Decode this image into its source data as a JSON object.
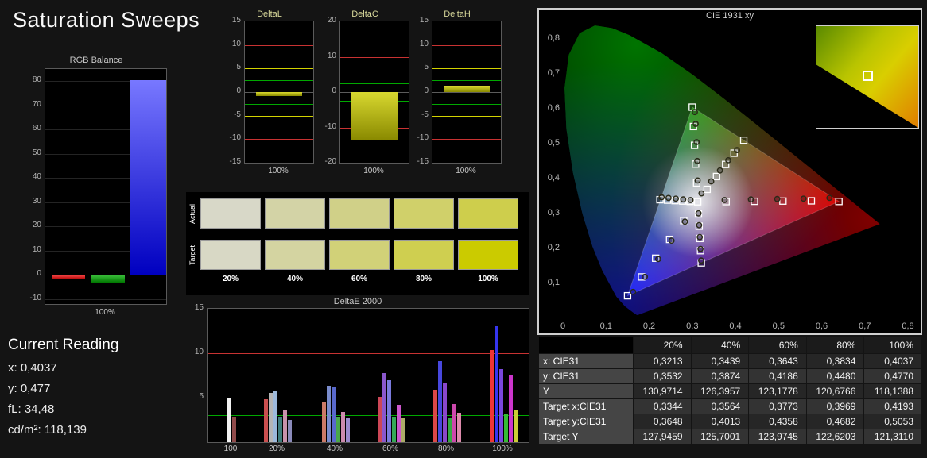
{
  "title": "Saturation Sweeps",
  "current_reading": {
    "heading": "Current Reading",
    "x": "x: 0,4037",
    "y": "y: 0,477",
    "fl": "fL: 34,48",
    "cd": "cd/m²: 118,139"
  },
  "chart_data": {
    "rgb_balance": {
      "type": "bar",
      "title": "RGB Balance",
      "categories": [
        "Red",
        "Green",
        "Blue"
      ],
      "values": [
        -1.7,
        -3.0,
        80.4
      ],
      "colors": [
        [
          "#ff5050",
          "#aa0000"
        ],
        [
          "#3fc43f",
          "#007700"
        ],
        [
          "#7878ff",
          "#0000c0"
        ]
      ],
      "ylim": [
        -12,
        85
      ],
      "yticks": [
        80,
        70,
        60,
        50,
        40,
        30,
        20,
        10,
        0,
        -10
      ],
      "xlabel": "100%"
    },
    "deltaL": {
      "type": "bar",
      "title": "DeltaL",
      "value": -0.9,
      "ylim": [
        -15,
        15
      ],
      "yticks": [
        15,
        10,
        5,
        0,
        -5,
        -10,
        -15
      ],
      "ref_lines": {
        "red": 10,
        "yellow": 5,
        "green": 2.5
      },
      "xlabel": "100%"
    },
    "deltaC": {
      "type": "bar",
      "title": "DeltaC",
      "value": -13.5,
      "ylim": [
        -20,
        20
      ],
      "yticks": [
        20,
        10,
        0,
        -10,
        -20
      ],
      "ref_lines": {
        "red": 10,
        "yellow": 5,
        "green": 2.5
      },
      "xlabel": "100%"
    },
    "deltaH": {
      "type": "bar",
      "title": "DeltaH",
      "value": 1.4,
      "ylim": [
        -15,
        15
      ],
      "yticks": [
        15,
        10,
        5,
        0,
        -5,
        -10,
        -15
      ],
      "ref_lines": {
        "red": 10,
        "yellow": 5,
        "green": 2.5
      },
      "xlabel": "100%"
    },
    "swatches": {
      "row_labels": [
        "Actual",
        "Target"
      ],
      "columns": [
        "20%",
        "40%",
        "60%",
        "80%",
        "100%"
      ],
      "actual": [
        "#d8d8c8",
        "#d3d3a6",
        "#d0d088",
        "#d0d06a",
        "#cece4c"
      ],
      "target": [
        "#d8d8c5",
        "#d4d4a1",
        "#d1d178",
        "#cfcf50",
        "#cbcb00"
      ]
    },
    "deltaE2000": {
      "type": "bar",
      "title": "DeltaE 2000",
      "ylim": [
        0,
        15
      ],
      "yticks": [
        15,
        10,
        5
      ],
      "ref_lines": {
        "red": 10,
        "yellow": 5,
        "green": 3
      },
      "groups": [
        {
          "label": "100",
          "bars": [
            {
              "color": "#f2f2f2",
              "v": 4.9
            },
            {
              "color": "#8f4a4a",
              "v": 2.9
            }
          ]
        },
        {
          "label": "20%",
          "bars": [
            {
              "color": "#c94f4f",
              "v": 4.8
            },
            {
              "color": "#b5b5b5",
              "v": 5.5
            },
            {
              "color": "#9cb8da",
              "v": 5.8
            },
            {
              "color": "#3f7d7d",
              "v": 2.9
            },
            {
              "color": "#c992ab",
              "v": 3.6
            },
            {
              "color": "#8a8aba",
              "v": 2.5
            }
          ]
        },
        {
          "label": "40%",
          "bars": [
            {
              "color": "#cc7a66",
              "v": 4.6
            },
            {
              "color": "#7a8ccc",
              "v": 6.3
            },
            {
              "color": "#5868cc",
              "v": 6.2
            },
            {
              "color": "#49a849",
              "v": 2.9
            },
            {
              "color": "#cc8aac",
              "v": 3.4
            },
            {
              "color": "#9b8acc",
              "v": 2.7
            }
          ]
        },
        {
          "label": "60%",
          "bars": [
            {
              "color": "#cc4757",
              "v": 5.1
            },
            {
              "color": "#8a57cc",
              "v": 7.8
            },
            {
              "color": "#7a7add",
              "v": 7.0
            },
            {
              "color": "#35a857",
              "v": 2.9
            },
            {
              "color": "#cc57cc",
              "v": 4.2
            },
            {
              "color": "#acac68",
              "v": 2.8
            }
          ]
        },
        {
          "label": "80%",
          "bars": [
            {
              "color": "#dd4747",
              "v": 5.9
            },
            {
              "color": "#4747dd",
              "v": 9.1
            },
            {
              "color": "#8a47cc",
              "v": 6.7
            },
            {
              "color": "#35a847",
              "v": 2.8
            },
            {
              "color": "#cc47ac",
              "v": 4.3
            },
            {
              "color": "#dd8aac",
              "v": 3.3
            }
          ]
        },
        {
          "label": "100%",
          "bars": [
            {
              "color": "#ee3535",
              "v": 10.4
            },
            {
              "color": "#3535ee",
              "v": 13.0
            },
            {
              "color": "#7a47dd",
              "v": 8.2
            },
            {
              "color": "#35bb35",
              "v": 3.2
            },
            {
              "color": "#cc35cc",
              "v": 7.5
            },
            {
              "color": "#cccc35",
              "v": 3.7
            }
          ]
        }
      ]
    },
    "cie": {
      "type": "scatter",
      "title": "CIE 1931 xy",
      "xlim": [
        0,
        0.8
      ],
      "ylim": [
        0,
        0.85
      ],
      "x_ticks": [
        "0",
        "0,1",
        "0,2",
        "0,3",
        "0,4",
        "0,5",
        "0,6",
        "0,7",
        "0,8"
      ],
      "y_ticks": [
        "0,1",
        "0,2",
        "0,3",
        "0,4",
        "0,5",
        "0,6",
        "0,7",
        "0,8"
      ],
      "gamut_triangle": [
        [
          0.64,
          0.33
        ],
        [
          0.3,
          0.6
        ],
        [
          0.15,
          0.06
        ]
      ],
      "white_point": [
        0.3127,
        0.329
      ],
      "target_points": [
        [
          0.3127,
          0.329
        ],
        [
          0.3344,
          0.3648
        ],
        [
          0.3564,
          0.4013
        ],
        [
          0.3773,
          0.4358
        ],
        [
          0.3969,
          0.4682
        ],
        [
          0.4193,
          0.5053
        ],
        [
          0.3785,
          0.3296
        ],
        [
          0.4443,
          0.3304
        ],
        [
          0.5102,
          0.3311
        ],
        [
          0.576,
          0.3319
        ],
        [
          0.64,
          0.33
        ],
        [
          0.3102,
          0.3829
        ],
        [
          0.3077,
          0.4368
        ],
        [
          0.3052,
          0.4907
        ],
        [
          0.3027,
          0.5446
        ],
        [
          0.3,
          0.6
        ],
        [
          0.2802,
          0.2752
        ],
        [
          0.2476,
          0.2214
        ],
        [
          0.2151,
          0.1676
        ],
        [
          0.1825,
          0.1138
        ],
        [
          0.15,
          0.06
        ],
        [
          0.2952,
          0.3302
        ],
        [
          0.2777,
          0.3314
        ],
        [
          0.2601,
          0.3326
        ],
        [
          0.2426,
          0.3338
        ],
        [
          0.225,
          0.335
        ],
        [
          0.3143,
          0.294
        ],
        [
          0.316,
          0.2591
        ],
        [
          0.3176,
          0.2241
        ],
        [
          0.3193,
          0.1892
        ],
        [
          0.3209,
          0.1542
        ]
      ],
      "measured_points": [
        [
          0.3213,
          0.3532
        ],
        [
          0.3439,
          0.3874
        ],
        [
          0.3643,
          0.4186
        ],
        [
          0.3834,
          0.448
        ],
        [
          0.4037,
          0.477
        ],
        [
          0.375,
          0.334
        ],
        [
          0.436,
          0.336
        ],
        [
          0.497,
          0.337
        ],
        [
          0.558,
          0.338
        ],
        [
          0.618,
          0.34
        ],
        [
          0.3125,
          0.39
        ],
        [
          0.3115,
          0.446
        ],
        [
          0.31,
          0.5
        ],
        [
          0.308,
          0.552
        ],
        [
          0.306,
          0.586
        ],
        [
          0.283,
          0.272
        ],
        [
          0.252,
          0.218
        ],
        [
          0.221,
          0.165
        ],
        [
          0.19,
          0.114
        ],
        [
          0.163,
          0.071
        ],
        [
          0.296,
          0.334
        ],
        [
          0.279,
          0.336
        ],
        [
          0.262,
          0.338
        ],
        [
          0.245,
          0.34
        ],
        [
          0.229,
          0.342
        ],
        [
          0.3145,
          0.296
        ],
        [
          0.316,
          0.262
        ],
        [
          0.3175,
          0.228
        ],
        [
          0.319,
          0.194
        ],
        [
          0.3205,
          0.161
        ]
      ]
    }
  },
  "table": {
    "columns": [
      "",
      "20%",
      "40%",
      "60%",
      "80%",
      "100%"
    ],
    "rows": [
      {
        "label": "x: CIE31",
        "values": [
          "0,3213",
          "0,3439",
          "0,3643",
          "0,3834",
          "0,4037"
        ]
      },
      {
        "label": "y: CIE31",
        "values": [
          "0,3532",
          "0,3874",
          "0,4186",
          "0,4480",
          "0,4770"
        ]
      },
      {
        "label": "Y",
        "values": [
          "130,9714",
          "126,3957",
          "123,1778",
          "120,6766",
          "118,1388"
        ]
      },
      {
        "label": "Target x:CIE31",
        "values": [
          "0,3344",
          "0,3564",
          "0,3773",
          "0,3969",
          "0,4193"
        ]
      },
      {
        "label": "Target y:CIE31",
        "values": [
          "0,3648",
          "0,4013",
          "0,4358",
          "0,4682",
          "0,5053"
        ]
      },
      {
        "label": "Target Y",
        "values": [
          "127,9459",
          "125,7001",
          "123,9745",
          "122,6203",
          "121,3110"
        ]
      }
    ]
  }
}
